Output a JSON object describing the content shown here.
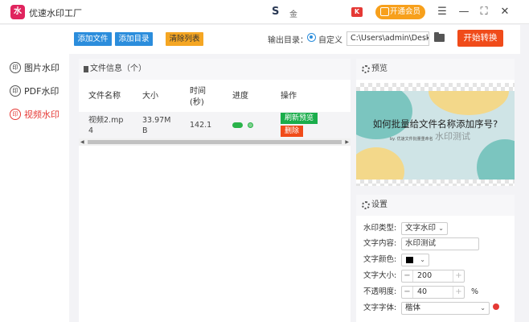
{
  "app": {
    "title": "优速水印工厂",
    "logo_text": "水",
    "user_logo": "S",
    "user_name": "金",
    "badge": "K",
    "vip_label": "开通会员",
    "menu_icon": "☰",
    "minimize_icon": "—",
    "maximize_icon": "⛶",
    "close_icon": "✕"
  },
  "sidebar": {
    "items": [
      {
        "label": "图片水印",
        "icon": "印",
        "active": false
      },
      {
        "label": "PDF水印",
        "icon": "印",
        "active": false
      },
      {
        "label": "视频水印",
        "icon": "印",
        "active": true
      }
    ]
  },
  "toolbar": {
    "add_file": "添加文件",
    "add_dir": "添加目录",
    "clear_list": "清除列表",
    "output_label": "输出目录：",
    "custom_label": "自定义",
    "path_value": "C:\\Users\\admin\\Desktop",
    "start_label": "开始转换"
  },
  "file_panel": {
    "title": "文件信息（个）",
    "columns": {
      "name": "文件名称",
      "size": "大小",
      "time_line1": "时间",
      "time_line2": "(秒)",
      "progress": "进度",
      "action": "操作"
    },
    "rows": [
      {
        "name_line1": "视频2.mp",
        "name_line2": "4",
        "size_line1": "33.97M",
        "size_line2": "B",
        "time": "142.1",
        "progress": 0.5,
        "refresh_label": "刷新预览",
        "delete_label": "删除"
      }
    ],
    "scroll_left": "◀",
    "scroll_right": "▶"
  },
  "preview": {
    "title": "预览",
    "image_title": "如何批量给文件名称添加序号?",
    "image_sub": "by. 优速文件批量重命名",
    "watermark": "水印测试"
  },
  "settings": {
    "title": "设置",
    "type_label": "水印类型:",
    "type_value": "文字水印",
    "content_label": "文字内容:",
    "content_value": "水印测试",
    "color_label": "文字颜色:",
    "color_value": "#000000",
    "size_label": "文字大小:",
    "size_value": "200",
    "opacity_label": "不透明度:",
    "opacity_value": "40",
    "opacity_unit": "%",
    "font_label": "文字字体:",
    "font_value": "楷体",
    "minus": "−",
    "plus": "+",
    "chevron": "⌄"
  }
}
